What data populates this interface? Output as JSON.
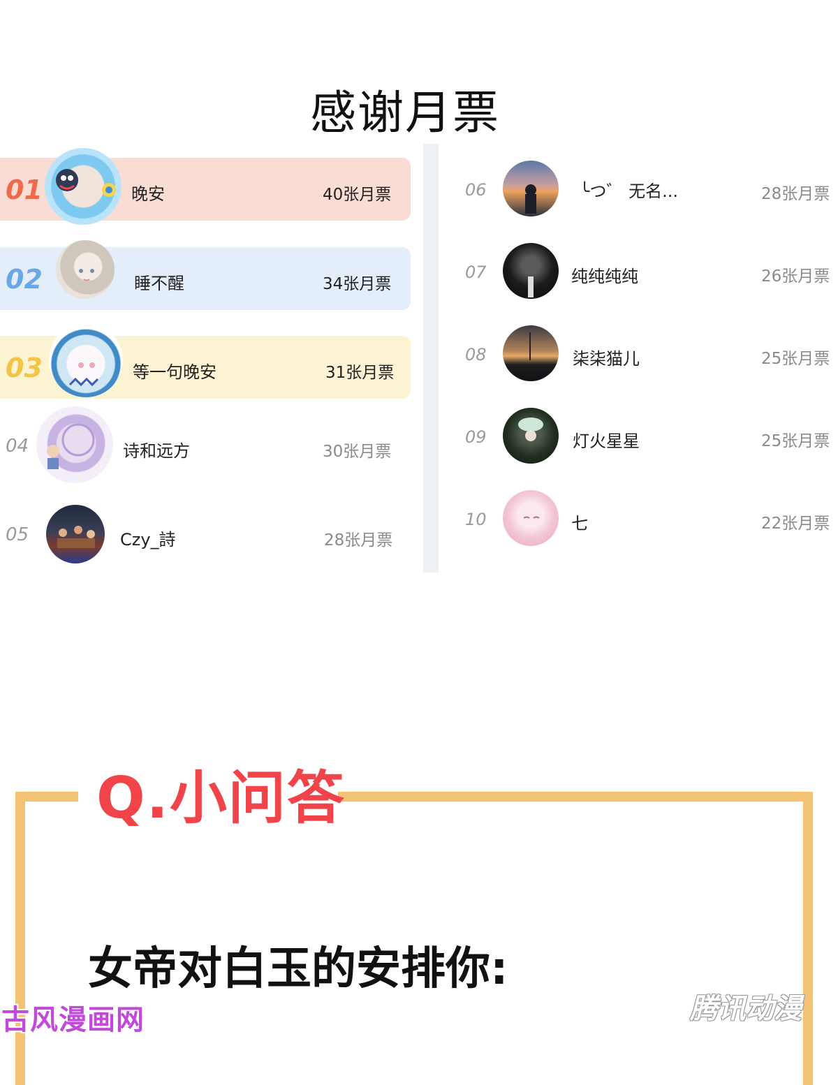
{
  "page": {
    "title": "感谢月票"
  },
  "colors": {
    "rank1_bg": "#f9ddd4",
    "rank1_num": "#ef6a4c",
    "rank2_bg": "#e4eefb",
    "rank2_num": "#6aa7e3",
    "rank3_bg": "#fcf3d3",
    "rank3_num": "#f2c546",
    "rank_other": "#9a9a9a",
    "qa_border": "#f3c272",
    "qa_title": "#f0434a"
  },
  "ranking": {
    "left": [
      {
        "rank": "01",
        "name": "晚安",
        "votes": "40张月票"
      },
      {
        "rank": "02",
        "name": "睡不醒",
        "votes": "34张月票"
      },
      {
        "rank": "03",
        "name": "等一句晚安",
        "votes": "31张月票"
      },
      {
        "rank": "04",
        "name": "诗和远方",
        "votes": "30张月票"
      },
      {
        "rank": "05",
        "name": "Czy_詩",
        "votes": "28张月票"
      }
    ],
    "right": [
      {
        "rank": "06",
        "name": "╰つ゛  无名...",
        "votes": "28张月票"
      },
      {
        "rank": "07",
        "name": "纯纯纯纯",
        "votes": "26张月票"
      },
      {
        "rank": "08",
        "name": "柒柒猫儿",
        "votes": "25张月票"
      },
      {
        "rank": "09",
        "name": "灯火星星",
        "votes": "25张月票"
      },
      {
        "rank": "10",
        "name": "七",
        "votes": "22张月票"
      }
    ]
  },
  "qa": {
    "title": "Q.小问答",
    "question": "女帝对白玉的安排你:"
  },
  "watermarks": {
    "left": "古风漫画网",
    "right": "腾讯动漫"
  }
}
